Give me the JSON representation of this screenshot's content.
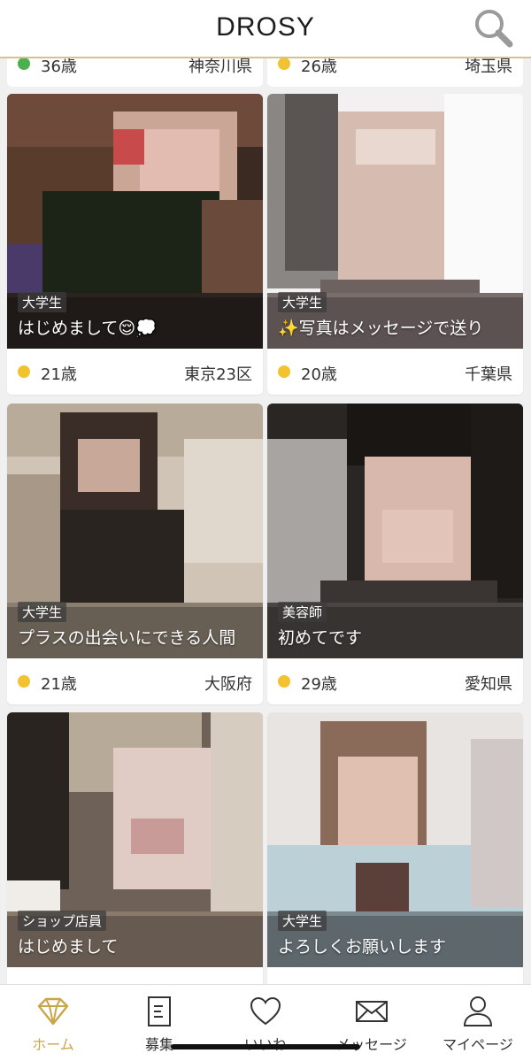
{
  "app": {
    "logo": "DROSY"
  },
  "colors": {
    "accent": "#c9a64a",
    "online": "#4caf50",
    "recent": "#f2c230"
  },
  "feed": {
    "partial_row": [
      {
        "age": "36歳",
        "prefecture": "神奈川県",
        "status": "online"
      },
      {
        "age": "26歳",
        "prefecture": "埼玉県",
        "status": "recent"
      }
    ],
    "cards": [
      {
        "occupation": "大学生",
        "tagline": "はじめまして😌💭",
        "age": "21歳",
        "prefecture": "東京23区",
        "status": "recent"
      },
      {
        "occupation": "大学生",
        "tagline": "✨写真はメッセージで送り",
        "age": "20歳",
        "prefecture": "千葉県",
        "status": "recent"
      },
      {
        "occupation": "大学生",
        "tagline": "プラスの出会いにできる人間",
        "age": "21歳",
        "prefecture": "大阪府",
        "status": "recent"
      },
      {
        "occupation": "美容師",
        "tagline": "初めてです",
        "age": "29歳",
        "prefecture": "愛知県",
        "status": "recent"
      },
      {
        "occupation": "ショップ店員",
        "tagline": "はじめまして",
        "age": "",
        "prefecture": "",
        "status": "recent"
      },
      {
        "occupation": "大学生",
        "tagline": "よろしくお願いします",
        "age": "",
        "prefecture": "",
        "status": "recent"
      }
    ]
  },
  "tabbar": {
    "tabs": [
      {
        "label": "ホーム",
        "icon": "diamond-icon",
        "active": true
      },
      {
        "label": "募集",
        "icon": "document-icon",
        "active": false
      },
      {
        "label": "いいね",
        "icon": "heart-icon",
        "active": false
      },
      {
        "label": "メッセージ",
        "icon": "envelope-icon",
        "active": false
      },
      {
        "label": "マイページ",
        "icon": "person-icon",
        "active": false
      }
    ]
  }
}
